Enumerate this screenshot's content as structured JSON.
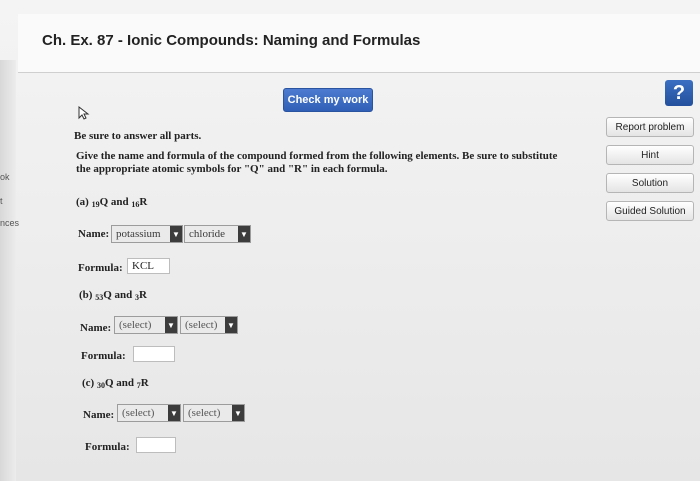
{
  "header": {
    "title": "Ch. Ex. 87 - Ionic Compounds: Naming and Formulas"
  },
  "toolbar": {
    "check_label": "Check my work",
    "help_label": "?"
  },
  "side_buttons": {
    "report": "Report problem",
    "hint": "Hint",
    "solution": "Solution",
    "guided": "Guided Solution"
  },
  "left_strip": {
    "k": "ok",
    "t": "t",
    "nces": "nces"
  },
  "question": {
    "intro": "Be sure to answer all parts.",
    "prompt_line1": "Give the name and formula of the compound formed from the following elements. Be sure to substitute",
    "prompt_line2": "the appropriate atomic symbols for \"Q\" and \"R\" in each formula.",
    "name_label": "Name:",
    "formula_label": "Formula:",
    "a": {
      "label_pre": "(a) ",
      "z1": "19",
      "e1": "Q",
      "and": " and ",
      "z2": "16",
      "e2": "R",
      "name1": "potassium",
      "name2": "chloride",
      "formula": "KCL"
    },
    "b": {
      "label_pre": "(b) ",
      "z1": "53",
      "e1": "Q",
      "and": " and ",
      "z2": "3",
      "e2": "R",
      "name1": "(select)",
      "name2": "(select)",
      "formula": ""
    },
    "c": {
      "label_pre": "(c) ",
      "z1": "30",
      "e1": "Q",
      "and": " and ",
      "z2": "7",
      "e2": "R",
      "name1": "(select)",
      "name2": "(select)",
      "formula": ""
    }
  }
}
